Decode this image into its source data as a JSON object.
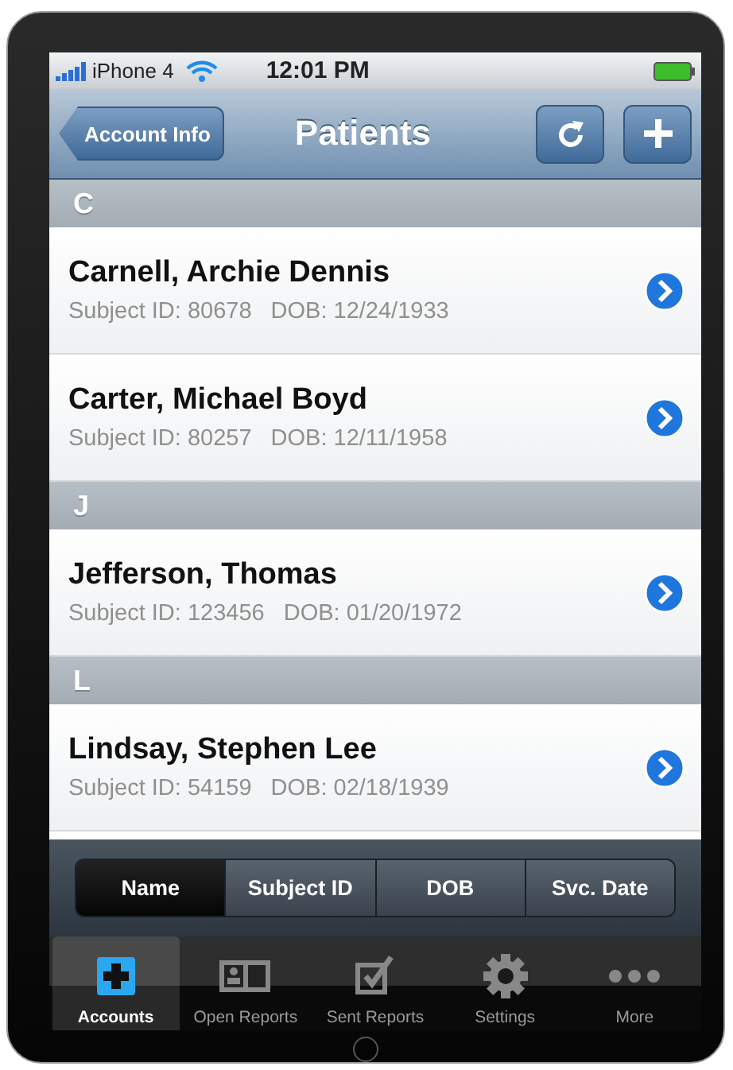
{
  "status_bar": {
    "carrier": "iPhone 4",
    "time": "12:01 PM"
  },
  "nav_bar": {
    "back": "Account Info",
    "title": "Patients"
  },
  "sections": [
    {
      "letter": "C",
      "patients": [
        {
          "name": "Carnell, Archie Dennis",
          "subject_id": "Subject ID: 80678",
          "dob": "DOB: 12/24/1933"
        },
        {
          "name": "Carter, Michael Boyd",
          "subject_id": "Subject ID: 80257",
          "dob": "DOB: 12/11/1958"
        }
      ]
    },
    {
      "letter": "J",
      "patients": [
        {
          "name": "Jefferson, Thomas",
          "subject_id": "Subject ID: 123456",
          "dob": "DOB: 01/20/1972"
        }
      ]
    },
    {
      "letter": "L",
      "patients": [
        {
          "name": "Lindsay, Stephen Lee",
          "subject_id": "Subject ID: 54159",
          "dob": "DOB: 02/18/1939"
        }
      ]
    }
  ],
  "sort_segments": [
    {
      "label": "Name",
      "selected": true
    },
    {
      "label": "Subject ID",
      "selected": false
    },
    {
      "label": "DOB",
      "selected": false
    },
    {
      "label": "Svc. Date",
      "selected": false
    }
  ],
  "tab_bar": [
    {
      "label": "Accounts",
      "kind": "add",
      "selected": true
    },
    {
      "label": "Open Reports",
      "kind": "reports",
      "selected": false
    },
    {
      "label": "Sent Reports",
      "kind": "check",
      "selected": false
    },
    {
      "label": "Settings",
      "kind": "gear",
      "selected": false
    },
    {
      "label": "More",
      "kind": "more",
      "selected": false
    }
  ]
}
